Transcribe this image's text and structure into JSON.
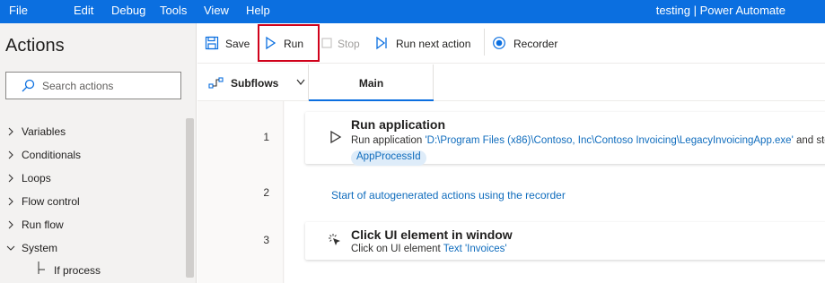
{
  "menu": {
    "items": [
      "File",
      "Edit",
      "Debug",
      "Tools",
      "View",
      "Help"
    ],
    "window_title": "testing | Power Automate"
  },
  "actions_pane": {
    "title": "Actions",
    "search_placeholder": "Search actions",
    "tree": [
      {
        "label": "Variables",
        "expanded": false
      },
      {
        "label": "Conditionals",
        "expanded": false
      },
      {
        "label": "Loops",
        "expanded": false
      },
      {
        "label": "Flow control",
        "expanded": false
      },
      {
        "label": "Run flow",
        "expanded": false
      },
      {
        "label": "System",
        "expanded": true
      }
    ],
    "sub_item": "If process"
  },
  "toolbar": {
    "save": "Save",
    "run": "Run",
    "stop": "Stop",
    "run_next": "Run next action",
    "recorder": "Recorder"
  },
  "tabs": {
    "subflows": "Subflows",
    "main": "Main"
  },
  "flow": {
    "line_numbers": [
      "1",
      "2",
      "3"
    ],
    "step1": {
      "title": "Run application",
      "desc_prefix": "Run application ",
      "desc_path": "'D:\\Program Files (x86)\\Contoso, Inc\\Contoso Invoicing\\LegacyInvoicingApp.exe'",
      "desc_suffix": " and store",
      "variable": "AppProcessId"
    },
    "step2_comment": "Start of autogenerated actions using the recorder",
    "step3": {
      "title": "Click UI element in window",
      "desc_prefix": "Click on UI element ",
      "desc_target": "Text 'Invoices'"
    }
  },
  "colors": {
    "accent": "#0b6fe0",
    "link": "#0f6cbd",
    "highlight": "#d0021b"
  }
}
